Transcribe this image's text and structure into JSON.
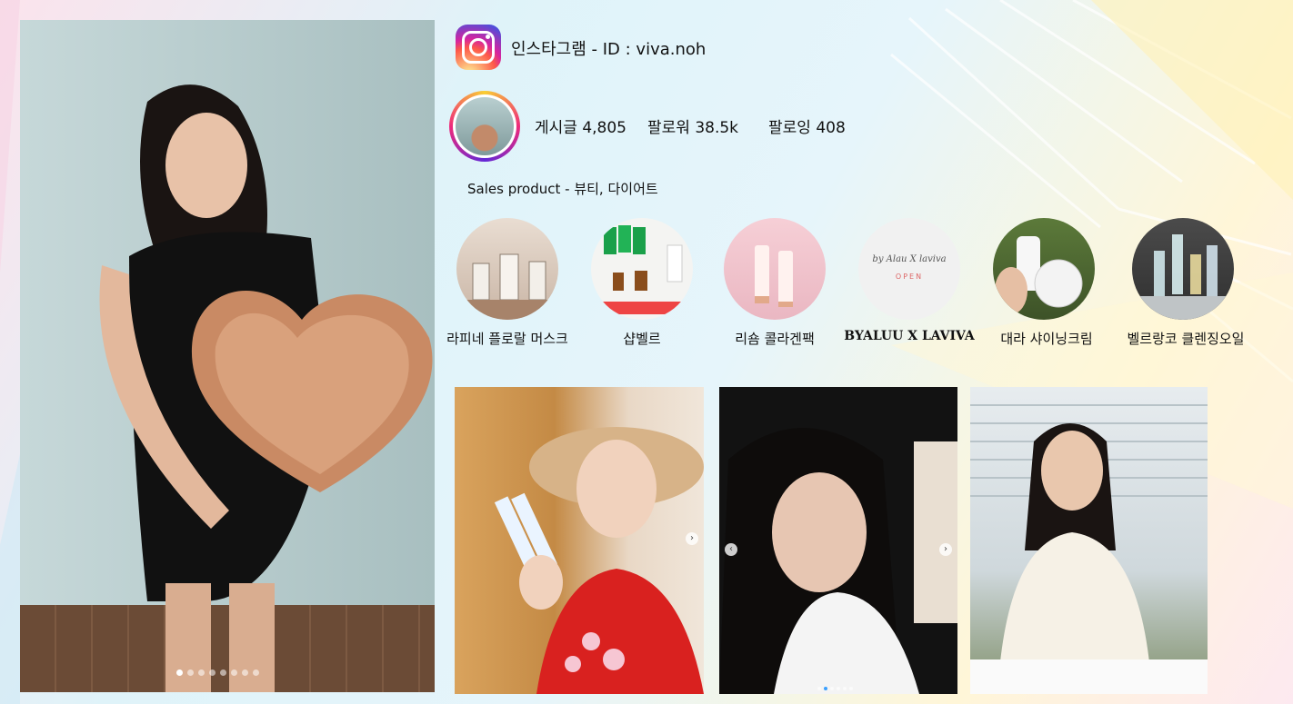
{
  "header": {
    "title": "인스타그램  - ID : viva.noh"
  },
  "profile": {
    "posts": "게시글 4,805",
    "followers": "팔로워 38.5k",
    "following": "팔로잉 408"
  },
  "sales": {
    "text": "Sales product  - 뷰티, 다이어트"
  },
  "highlights": [
    {
      "label": "라피네 플로랄 머스크"
    },
    {
      "label": "샵벨르"
    },
    {
      "label": "리숌 콜라겐팩"
    },
    {
      "label": "BYALUU X LAVIVA"
    },
    {
      "label": "대라 샤이닝크림"
    },
    {
      "label": "벨르랑코 클렌징오일"
    }
  ],
  "highlight_inner": {
    "byaluu_script": "by Alau X laviva",
    "byaluu_open": "OPEN"
  },
  "main_photo": {
    "slides": 8,
    "active_slide": 1
  },
  "colors": {
    "ig_pink": "#ee2a7b",
    "ig_yellow": "#f9ce34",
    "ig_purple": "#6228d7"
  }
}
